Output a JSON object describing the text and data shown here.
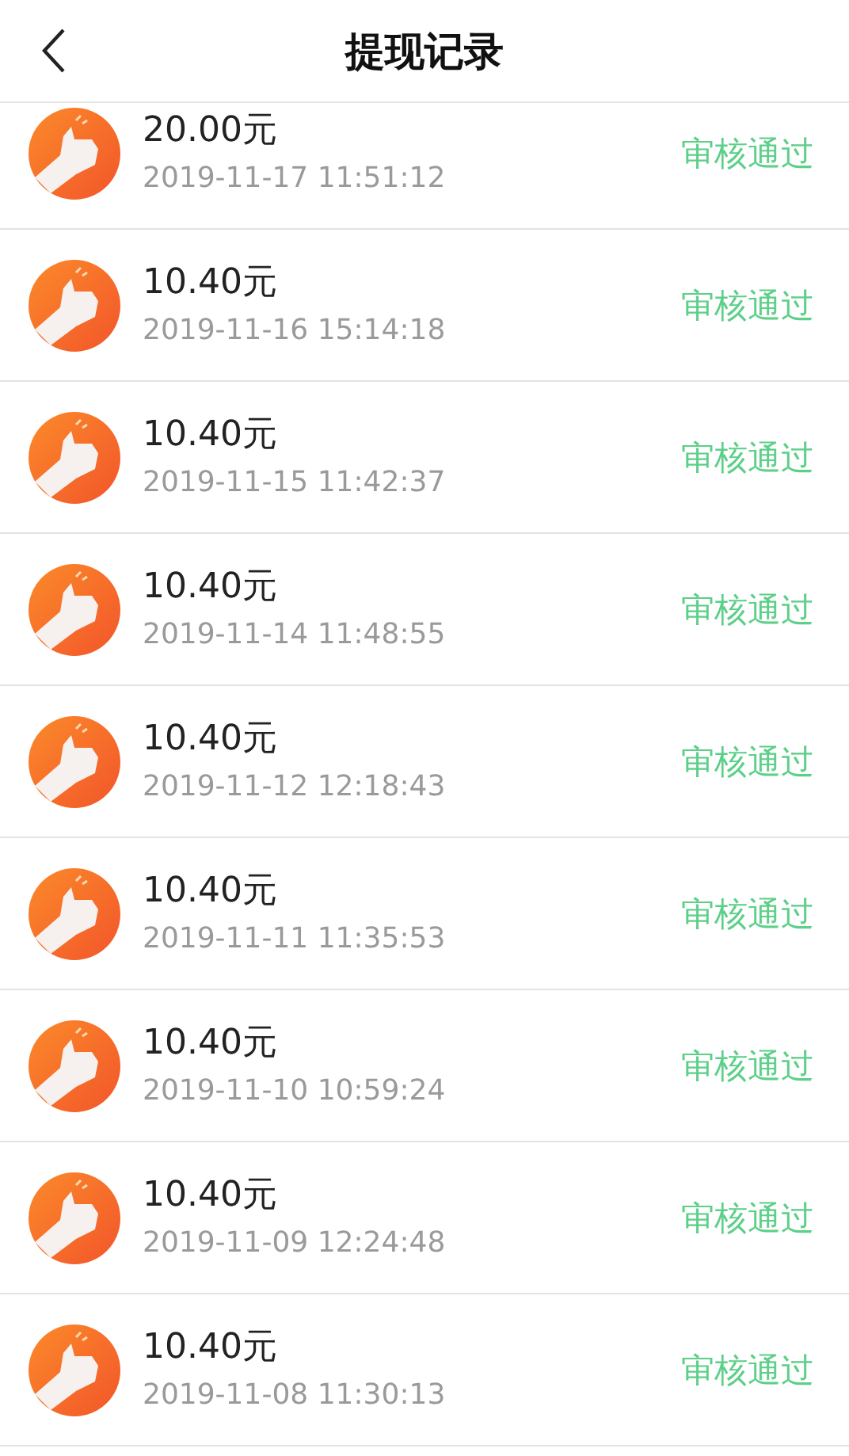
{
  "header": {
    "title": "提现记录"
  },
  "records": [
    {
      "amount": "20.00元",
      "time": "2019-11-17 11:51:12",
      "status": "审核通过"
    },
    {
      "amount": "10.40元",
      "time": "2019-11-16 15:14:18",
      "status": "审核通过"
    },
    {
      "amount": "10.40元",
      "time": "2019-11-15 11:42:37",
      "status": "审核通过"
    },
    {
      "amount": "10.40元",
      "time": "2019-11-14 11:48:55",
      "status": "审核通过"
    },
    {
      "amount": "10.40元",
      "time": "2019-11-12 12:18:43",
      "status": "审核通过"
    },
    {
      "amount": "10.40元",
      "time": "2019-11-11 11:35:53",
      "status": "审核通过"
    },
    {
      "amount": "10.40元",
      "time": "2019-11-10 10:59:24",
      "status": "审核通过"
    },
    {
      "amount": "10.40元",
      "time": "2019-11-09 12:24:48",
      "status": "审核通过"
    },
    {
      "amount": "10.40元",
      "time": "2019-11-08 11:30:13",
      "status": "审核通过"
    }
  ]
}
